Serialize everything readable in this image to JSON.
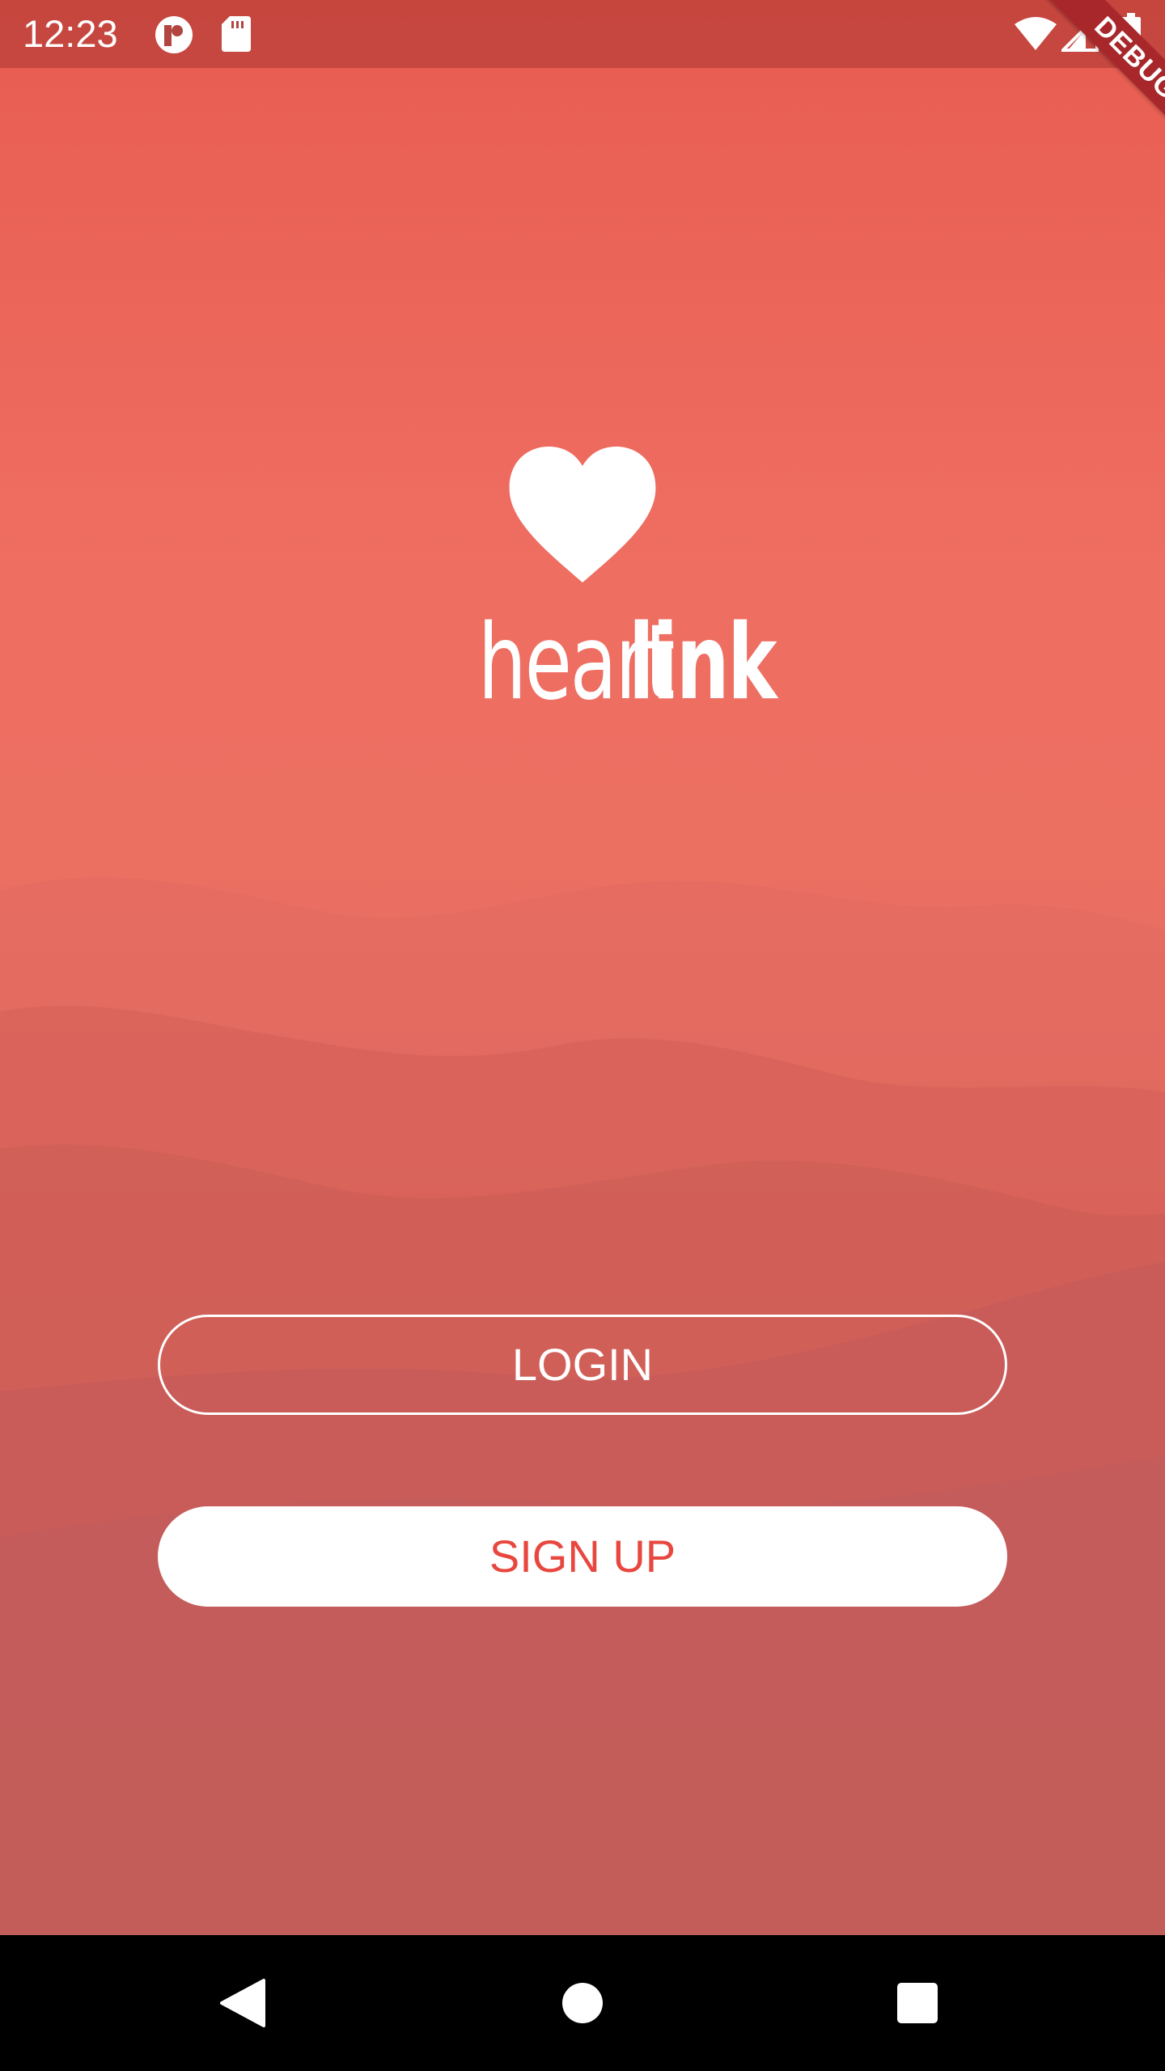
{
  "status_bar": {
    "time": "12:23",
    "icons": [
      "notification-app-icon",
      "sd-card-icon",
      "wifi-icon",
      "cell-signal-icon",
      "battery-icon"
    ]
  },
  "debug_banner": {
    "label": "DEBUG",
    "color": "#a8272a"
  },
  "logo": {
    "icon": "heart-icon",
    "wordmark_light": "heart",
    "wordmark_bold": "link"
  },
  "buttons": {
    "login_label": "LOGIN",
    "signup_label": "SIGN UP"
  },
  "nav_bar": {
    "icons": [
      "back-icon",
      "home-icon",
      "recents-icon"
    ]
  },
  "colors": {
    "brand_red": "#e8473f",
    "background_top": "#e85c50",
    "background_bottom": "#bb6566",
    "white": "#ffffff"
  }
}
